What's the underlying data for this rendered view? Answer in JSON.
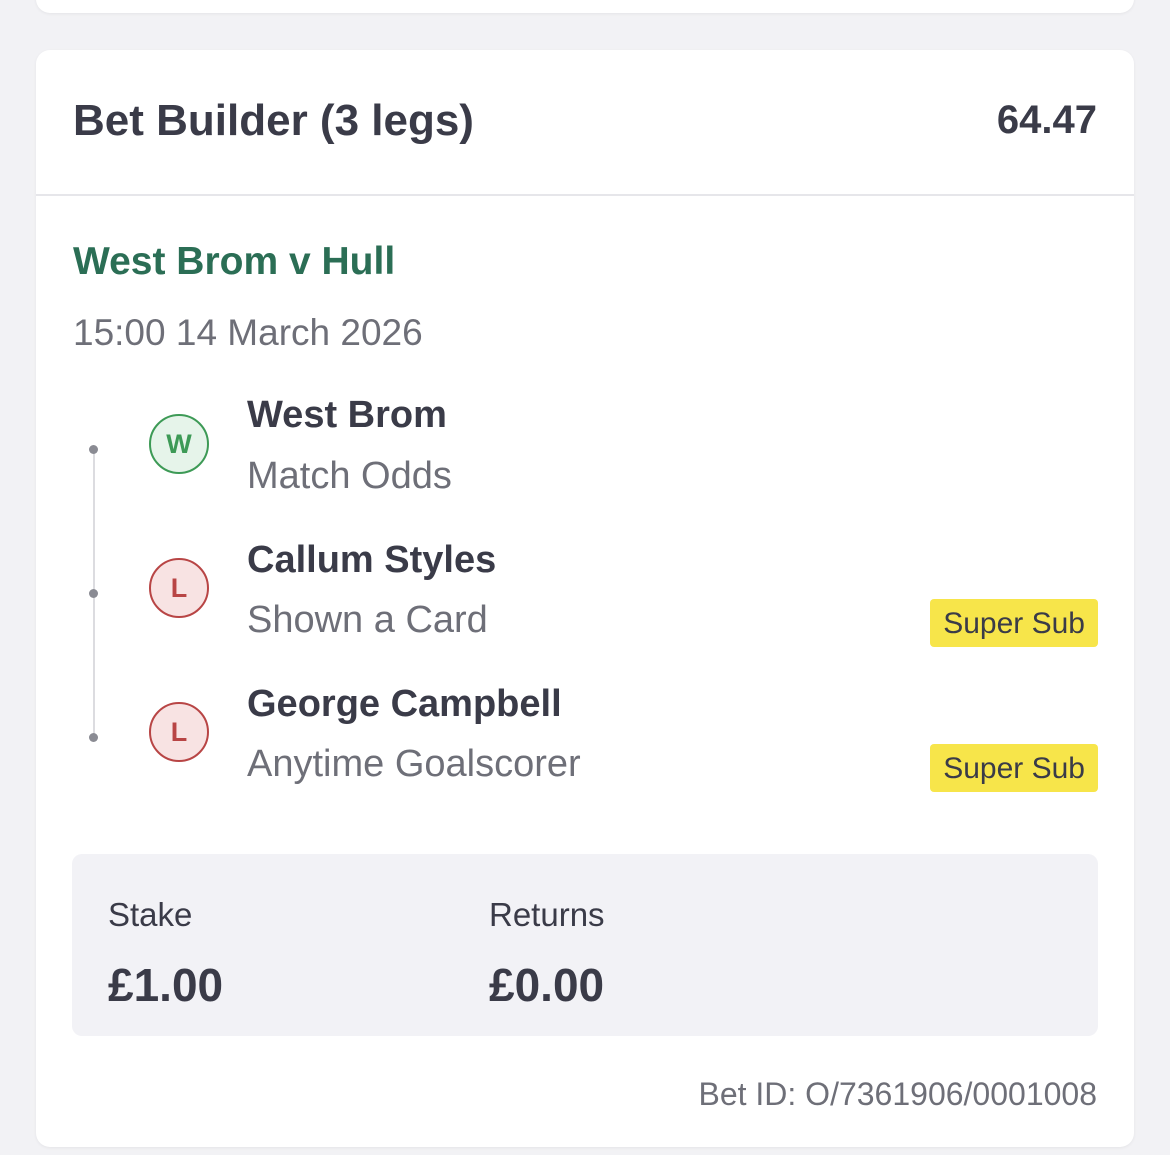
{
  "bet": {
    "title": "Bet Builder (3 legs)",
    "odds": "64.47",
    "event_name": "West Brom v Hull",
    "event_time": "15:00 14 March 2026",
    "legs": [
      {
        "result": "W",
        "selection": "West Brom",
        "market": "Match Odds",
        "tag": ""
      },
      {
        "result": "L",
        "selection": "Callum Styles",
        "market": "Shown a Card",
        "tag": "Super Sub"
      },
      {
        "result": "L",
        "selection": "George Campbell",
        "market": "Anytime Goalscorer",
        "tag": "Super Sub"
      }
    ],
    "stake_label": "Stake",
    "stake_value": "£1.00",
    "returns_label": "Returns",
    "returns_value": "£0.00",
    "bet_id": "Bet ID: O/7361906/0001008"
  },
  "colors": {
    "event_name": "#2b6e55",
    "win": "#3d9a56",
    "loss": "#b84545",
    "super_sub": "#f7e54a",
    "text": "#3a3b48",
    "muted": "#6e6f78"
  },
  "icons": {
    "win_badge": "win-badge-icon",
    "loss_badge": "loss-badge-icon"
  }
}
